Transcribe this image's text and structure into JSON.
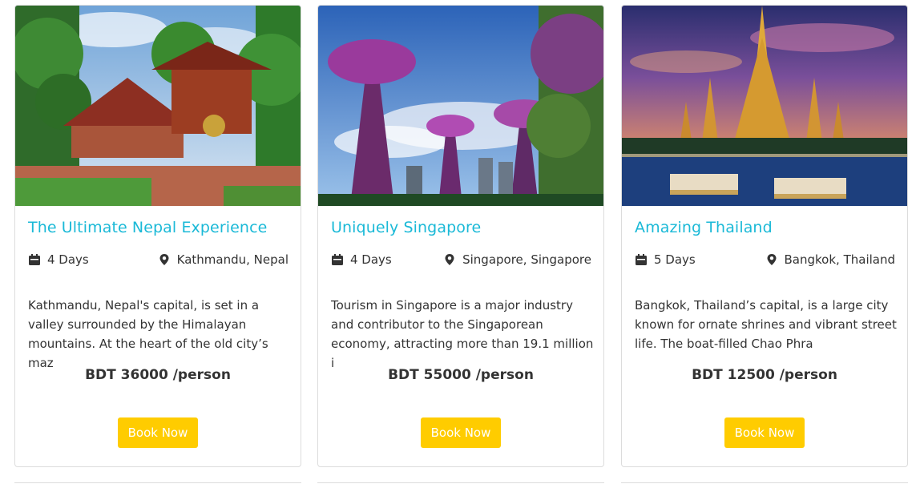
{
  "packages": [
    {
      "title": "The Ultimate Nepal Experience",
      "duration": "4 Days",
      "location": "Kathmandu, Nepal",
      "description": "Kathmandu, Nepal's capital, is set in a valley surrounded by the Himalayan mountains. At the heart of the old city’s maz",
      "price": "BDT 36000 /person",
      "button": "Book Now",
      "image_icon": "nepal-temple-photo"
    },
    {
      "title": "Uniquely Singapore",
      "duration": "4 Days",
      "location": "Singapore, Singapore",
      "description": "Tourism in Singapore is a major industry and contributor to the Singaporean economy, attracting more than 19.1 million i",
      "price": "BDT 55000 /person",
      "button": "Book Now",
      "image_icon": "singapore-supertrees-photo"
    },
    {
      "title": "Amazing Thailand",
      "duration": "5 Days",
      "location": "Bangkok, Thailand",
      "description": "Bangkok, Thailand’s capital, is a large city known for ornate shrines and vibrant street life. The boat-filled Chao Phra",
      "price": "BDT 12500 /person",
      "button": "Book Now",
      "image_icon": "bangkok-temple-photo"
    }
  ],
  "colors": {
    "title": "#1ab9d7",
    "button": "#ffcc00",
    "text": "#333333",
    "border": "#dcdcdc"
  },
  "icons": {
    "duration": "calendar-icon",
    "location": "map-marker-icon"
  }
}
